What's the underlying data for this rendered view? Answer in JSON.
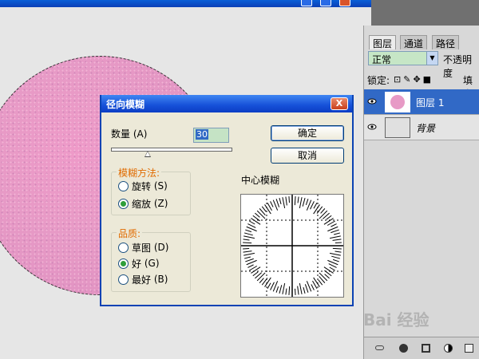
{
  "dialog": {
    "title": "径向模糊",
    "close_label": "X",
    "amount_label": "数量",
    "amount_key": "(A)",
    "amount_value": "30",
    "amount_slider_fraction": 0.3,
    "ok_label": "确定",
    "cancel_label": "取消",
    "blur_method": {
      "title": "模糊方法:",
      "options": [
        {
          "label": "旋转",
          "key": "(S)",
          "selected": false
        },
        {
          "label": "缩放",
          "key": "(Z)",
          "selected": true
        }
      ]
    },
    "quality": {
      "title": "品质:",
      "options": [
        {
          "label": "草图",
          "key": "(D)",
          "selected": false
        },
        {
          "label": "好",
          "key": "(G)",
          "selected": true
        },
        {
          "label": "最好",
          "key": "(B)",
          "selected": false
        }
      ]
    },
    "center_label": "中心模糊"
  },
  "layers_panel": {
    "tabs": [
      "图层",
      "通道",
      "路径"
    ],
    "blend_mode": "正常",
    "opacity_label": "不透明度",
    "lock_label": "锁定:",
    "fill_label": "填充",
    "layers": [
      {
        "name": "图层 1",
        "selected": true
      },
      {
        "name": "背景",
        "selected": false
      }
    ]
  },
  "watermark": "Bai 经验",
  "colors": {
    "titlebar": "#1650d8",
    "dialog_bg": "#ece9d8",
    "group_title": "#e06b00",
    "selected_layer": "#3169c6",
    "circle": "#e79ac6"
  }
}
